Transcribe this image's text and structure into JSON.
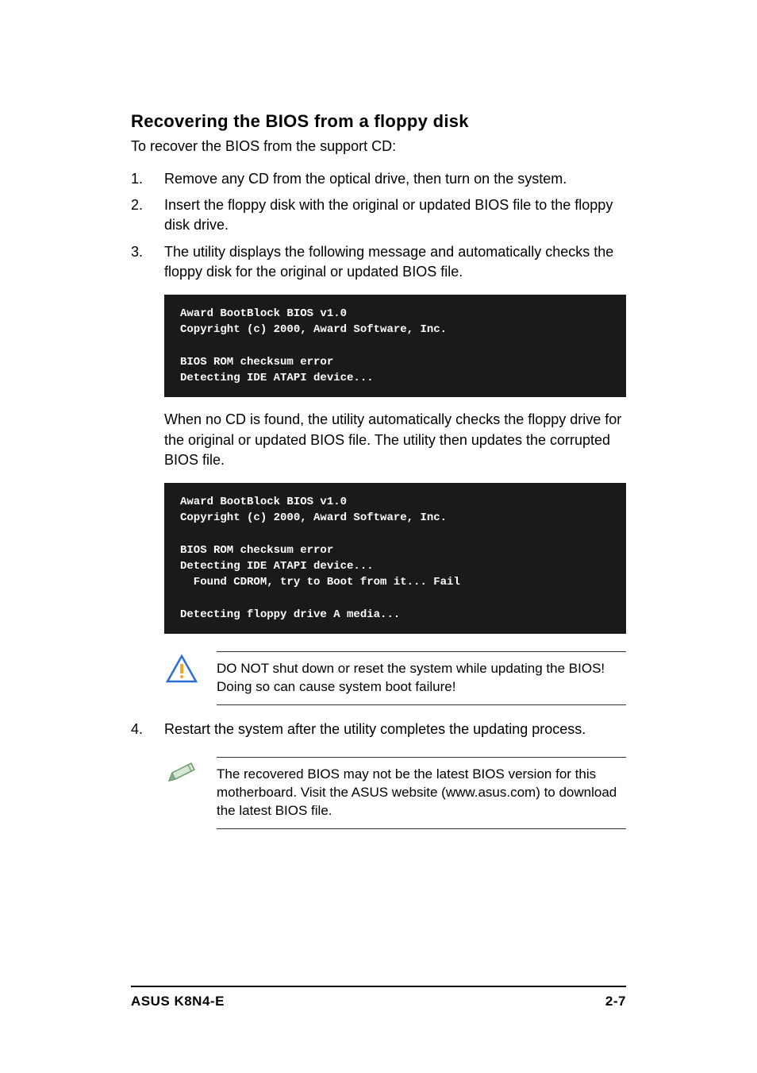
{
  "heading": "Recovering the BIOS from a floppy disk",
  "intro": "To recover the BIOS from the support CD:",
  "steps": {
    "s1": {
      "num": "1.",
      "text": "Remove any CD from the optical drive, then turn on the system."
    },
    "s2": {
      "num": "2.",
      "text": "Insert the floppy disk with the original or updated BIOS file to the floppy disk drive."
    },
    "s3": {
      "num": "3.",
      "text": "The utility displays the following message and automatically checks the floppy disk for the original or updated BIOS file."
    },
    "s4": {
      "num": "4.",
      "text": "Restart the system after the utility completes the updating process."
    }
  },
  "code_block_1": "Award BootBlock BIOS v1.0\nCopyright (c) 2000, Award Software, Inc.\n\nBIOS ROM checksum error\nDetecting IDE ATAPI device...",
  "paragraph_after_code1": "When no CD is found, the utility automatically checks the floppy drive for the original or updated BIOS file. The utility then updates the corrupted BIOS file.",
  "code_block_2": "Award BootBlock BIOS v1.0\nCopyright (c) 2000, Award Software, Inc.\n\nBIOS ROM checksum error\nDetecting IDE ATAPI device...\n  Found CDROM, try to Boot from it... Fail\n\nDetecting floppy drive A media...",
  "warning_text": "DO NOT shut down or reset the system while updating the BIOS! Doing so can cause system boot failure!",
  "note_text": "The recovered BIOS may not be the latest BIOS version for this motherboard. Visit the ASUS website (www.asus.com) to download the latest BIOS file.",
  "footer": {
    "left": "ASUS K8N4-E",
    "right": "2-7"
  }
}
